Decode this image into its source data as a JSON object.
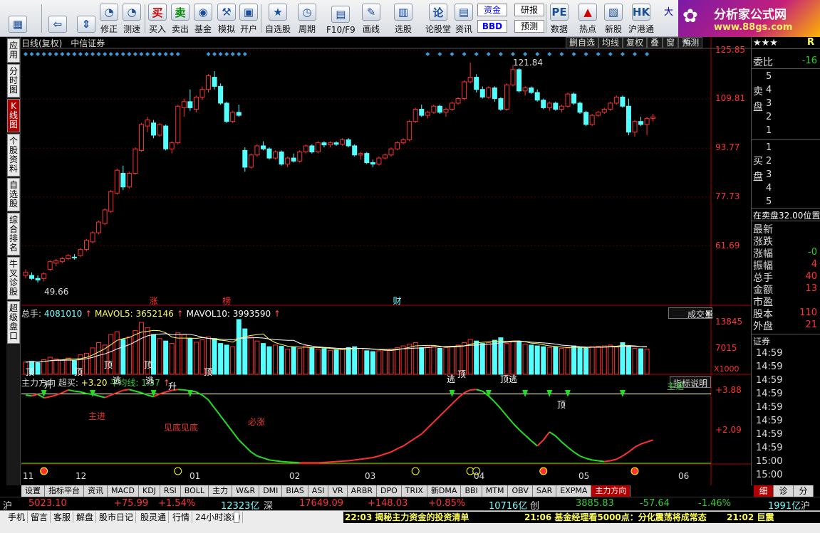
{
  "toolbar": {
    "buttons": [
      {
        "label": "",
        "icon": "app-menu-icon",
        "x": 12
      },
      {
        "label": "",
        "icon": "back-arrow-icon",
        "x": 68
      },
      {
        "label": "",
        "icon": "up-down-icon",
        "x": 108
      },
      {
        "label": "修正",
        "icon": "clock-icon",
        "x": 140
      },
      {
        "label": "测速",
        "icon": "clock-icon",
        "x": 172
      },
      {
        "label": "买入",
        "icon": "buy-icon",
        "glyph": "买",
        "x": 208
      },
      {
        "label": "卖出",
        "icon": "sell-icon",
        "glyph": "卖",
        "x": 240
      },
      {
        "label": "基金",
        "icon": "fund-icon",
        "x": 272
      },
      {
        "label": "模拟",
        "icon": "hammer-icon",
        "x": 305
      },
      {
        "label": "开户",
        "icon": "lock-icon",
        "x": 336
      },
      {
        "label": "自选股",
        "icon": "star-icon",
        "x": 372
      },
      {
        "label": "周期",
        "icon": "cycle-icon",
        "x": 418
      },
      {
        "label": "F10/F9",
        "icon": "f10-icon",
        "x": 458
      },
      {
        "label": "画线",
        "icon": "pen-icon",
        "x": 508
      },
      {
        "label": "选股",
        "icon": "select-icon",
        "x": 553
      },
      {
        "label": "论股堂",
        "icon": "forum-icon",
        "glyph": "论",
        "x": 597
      },
      {
        "label": "资讯",
        "icon": "news-icon",
        "x": 638
      },
      {
        "label": "数据",
        "icon": "pe-icon",
        "glyph": "PE",
        "x": 772
      },
      {
        "label": "热点",
        "icon": "hot-icon",
        "x": 812
      },
      {
        "label": "新股",
        "icon": "new-stock-icon",
        "x": 848
      },
      {
        "label": "沪港通",
        "icon": "hk-icon",
        "glyph": "HK",
        "x": 882
      }
    ],
    "fund_label": "资金",
    "bbd_label": "BBD",
    "research_label": "研报",
    "forecast_label": "预测",
    "big_label": "大"
  },
  "brand": {
    "name": "分析家公式网",
    "url": "www.88gs.com"
  },
  "left_tabs": [
    {
      "label": "应用"
    },
    {
      "label": "分时图"
    },
    {
      "label": "K线图",
      "active": true
    },
    {
      "label": "个股资料"
    },
    {
      "label": "自选股"
    },
    {
      "label": "综合排名"
    },
    {
      "label": "牛叉诊股"
    },
    {
      "label": "超级盘口"
    }
  ],
  "chart_header": {
    "left": "日线(复权)",
    "stock": "中信证券",
    "buttons": [
      "删自选",
      "均线",
      "复权",
      "叠",
      "窗",
      "预测"
    ]
  },
  "price_axis": [
    "125.85",
    "109.81",
    "93.77",
    "77.73",
    "61.69"
  ],
  "annotations": {
    "high": "121.84",
    "low": "49.66",
    "events": [
      {
        "t": "涨",
        "i": 21
      },
      {
        "t": "榜",
        "i": 33
      },
      {
        "t": "财",
        "i": 61
      }
    ]
  },
  "volume": {
    "label": "总手:",
    "value": "4081010",
    "mavol5_label": "MAVOL5:",
    "mavol5": "3652146",
    "mavol10_label": "MAVOL10:",
    "mavol10": "3993590",
    "axis_top": "13845",
    "axis_mid": "7015",
    "axis_unit": "X1000",
    "selector": "成交量"
  },
  "indicator": {
    "name": "主力方向",
    "chao_label": "超买:",
    "chao": "+3.20",
    "avg_label": "平均线:",
    "avg": "1.37",
    "help": "指标说明",
    "axis_top": "+3.88",
    "axis_mid": "+2.09",
    "texts": [
      {
        "t": "顶",
        "x": 6,
        "y": 514,
        "c": "#fff"
      },
      {
        "t": "升",
        "x": 32,
        "y": 532,
        "c": "#fff"
      },
      {
        "t": "顶",
        "x": 74,
        "y": 514,
        "c": "#fff"
      },
      {
        "t": "顶",
        "x": 116,
        "y": 504,
        "c": "#fff"
      },
      {
        "t": "逃",
        "x": 128,
        "y": 526,
        "c": "#fff"
      },
      {
        "t": "顶",
        "x": 172,
        "y": 504,
        "c": "#fff"
      },
      {
        "t": "逃",
        "x": 174,
        "y": 526,
        "c": "#fff"
      },
      {
        "t": "升",
        "x": 206,
        "y": 534,
        "c": "#fff"
      },
      {
        "t": "顶",
        "x": 256,
        "y": 514,
        "c": "#fff"
      },
      {
        "t": "主进",
        "x": 94,
        "y": 576,
        "c": "#e33"
      },
      {
        "t": "见底见底",
        "x": 200,
        "y": 592,
        "c": "#e33"
      },
      {
        "t": "必涨",
        "x": 318,
        "y": 584,
        "c": "#e33"
      },
      {
        "t": "逃",
        "x": 597,
        "y": 524,
        "c": "#fff"
      },
      {
        "t": "顶",
        "x": 612,
        "y": 517,
        "c": "#fff"
      },
      {
        "t": "顶逃",
        "x": 672,
        "y": 524,
        "c": "#fff"
      },
      {
        "t": "顶",
        "x": 752,
        "y": 560,
        "c": "#fff"
      },
      {
        "t": "主退",
        "x": 906,
        "y": 534,
        "c": "#3c3"
      }
    ]
  },
  "date_axis": [
    {
      "t": "11",
      "x": 2
    },
    {
      "t": "12",
      "x": 76
    },
    {
      "t": "01",
      "x": 236
    },
    {
      "t": "02",
      "x": 376
    },
    {
      "t": "03",
      "x": 482
    },
    {
      "t": "04",
      "x": 635
    },
    {
      "t": "05",
      "x": 782
    },
    {
      "t": "06",
      "x": 922
    }
  ],
  "right_panel": {
    "stars": "★★★",
    "r": "R",
    "weibi_label": "委比",
    "weibi": "-16",
    "sell_label": "卖\n盘",
    "buy_label": "买\n盘",
    "sell_levels": [
      "5",
      "4",
      "3",
      "2",
      "1"
    ],
    "buy_levels": [
      "1",
      "2",
      "3",
      "4",
      "5"
    ],
    "info": "在卖盘32.00位置",
    "fields": [
      {
        "k": "最新",
        "v": ""
      },
      {
        "k": "涨跌",
        "v": ""
      },
      {
        "k": "涨幅",
        "v": "-0"
      },
      {
        "k": "振幅",
        "v": "4"
      },
      {
        "k": "总手",
        "v": "40"
      },
      {
        "k": "金额",
        "v": "13"
      },
      {
        "k": "市盈",
        "v": ""
      },
      {
        "k": "股本",
        "v": "110"
      },
      {
        "k": "外盘",
        "v": "21"
      }
    ],
    "sec_label": "证券",
    "times": [
      "14:59",
      "14:59",
      "14:59",
      "14:59",
      "14:59",
      "14:59",
      "14:59",
      "14:59",
      "15:00",
      "15:00"
    ],
    "tabs": [
      "细",
      "诊",
      "分"
    ]
  },
  "bottom_tabs": [
    "设置",
    "指标平台",
    "资讯",
    "MACD",
    "KDJ",
    "RSI",
    "BOLL",
    "主力",
    "W&R",
    "DMI",
    "BIAS",
    "ASI",
    "VR",
    "ARBR",
    "DPO",
    "TRIX",
    "新DMA",
    "BBI",
    "MTM",
    "OBV",
    "SAR",
    "EXPMA",
    "主力方向"
  ],
  "ticker": {
    "sh_label": "沪",
    "sh": "5023.10",
    "sh_chg": "+75.99",
    "sh_pct": "+1.54%",
    "sh_amt": "12323亿",
    "sz_label": "深",
    "sz": "17649.09",
    "sz_chg": "+148.03",
    "sz_pct": "+0.85%",
    "sz_amt": "10716亿",
    "cy_label": "创",
    "cy": "3885.83",
    "cy_chg": "-57.64",
    "cy_pct": "-1.46%",
    "r_amt": "1991亿",
    "r_label": "沪"
  },
  "status": {
    "buttons": [
      "手机",
      "留言",
      "客服",
      "解盘",
      "股市日记",
      "股灵通",
      "行情",
      "24小时滚动"
    ],
    "news": [
      "22:03 揭秘主力资金的投资清单",
      "21:06 基金经理看5000点：分化震荡将成常态",
      "21:02 巨震"
    ]
  },
  "colors": {
    "up": "#ff3030",
    "down": "#54ffff",
    "grid": "#4a0000",
    "axis": "#b00000",
    "yellow": "#ffff55",
    "green": "#22dd22"
  },
  "chart_data": {
    "type": "candlestick",
    "title": "中信证券 日线(复权)",
    "ylim": [
      45,
      126
    ],
    "high": 121.84,
    "low": 49.66,
    "ohlc": [
      [
        52,
        54,
        51,
        53
      ],
      [
        52,
        53,
        50.5,
        51
      ],
      [
        51,
        52,
        49.66,
        50.5
      ],
      [
        51,
        53,
        50,
        52.5
      ],
      [
        54,
        57,
        53.5,
        56.5
      ],
      [
        56,
        57.5,
        55,
        56.8
      ],
      [
        56.5,
        58,
        56,
        57.5
      ],
      [
        57.5,
        59,
        57,
        58.5
      ],
      [
        58,
        59,
        57.2,
        57.8
      ],
      [
        58.5,
        61,
        58,
        60.5
      ],
      [
        60.5,
        64,
        60,
        63.5
      ],
      [
        63,
        66.5,
        62.5,
        66
      ],
      [
        66,
        70,
        65.5,
        69.5
      ],
      [
        69,
        74,
        68.5,
        73.5
      ],
      [
        73,
        80,
        72.5,
        79.5
      ],
      [
        79,
        87,
        78.5,
        86.5
      ],
      [
        85.5,
        88,
        80,
        81
      ],
      [
        81,
        86,
        80.5,
        85.5
      ],
      [
        85.5,
        94,
        85,
        93.5
      ],
      [
        93,
        102,
        92.5,
        101.5
      ],
      [
        101,
        104,
        99,
        103
      ],
      [
        102,
        103,
        97,
        98
      ],
      [
        98,
        102,
        97.5,
        101.5
      ],
      [
        101,
        101.5,
        93,
        93.5
      ],
      [
        93.5,
        96,
        92,
        95.5
      ],
      [
        95.5,
        108,
        95,
        107.5
      ],
      [
        107,
        110,
        104,
        109
      ],
      [
        109,
        113,
        106,
        107
      ],
      [
        106.5,
        111,
        105.5,
        110.5
      ],
      [
        110.5,
        114,
        109.5,
        113
      ],
      [
        113,
        118,
        112,
        117.5
      ],
      [
        117,
        119,
        113,
        114
      ],
      [
        114,
        115,
        108,
        108.5
      ],
      [
        108.5,
        109,
        102,
        102.5
      ],
      [
        102.5,
        106,
        102,
        105.5
      ],
      [
        105.5,
        108,
        104,
        104.5
      ],
      [
        93,
        94,
        86,
        87.5
      ],
      [
        87.5,
        92,
        87,
        91.5
      ],
      [
        91.5,
        95,
        91,
        94.5
      ],
      [
        94.5,
        96,
        93,
        93.5
      ],
      [
        93.5,
        94,
        90,
        90.5
      ],
      [
        90.5,
        93,
        90,
        92.5
      ],
      [
        92.5,
        93,
        88,
        88.5
      ],
      [
        88.5,
        91,
        87.5,
        90.5
      ],
      [
        90.5,
        92,
        89,
        89.5
      ],
      [
        89.5,
        93,
        89,
        92.5
      ],
      [
        92.5,
        95,
        92,
        94.5
      ],
      [
        94.5,
        95,
        92,
        92.5
      ],
      [
        92.5,
        96,
        92,
        95.5
      ],
      [
        95.5,
        96,
        94,
        94.8
      ],
      [
        94.8,
        96,
        94,
        95.5
      ],
      [
        95.5,
        96,
        94.5,
        95
      ],
      [
        95,
        97,
        94.5,
        96.5
      ],
      [
        96.5,
        97,
        94,
        94.5
      ],
      [
        94.5,
        95,
        91,
        91.5
      ],
      [
        91.5,
        92.5,
        90,
        92
      ],
      [
        92,
        92.5,
        88.5,
        89
      ],
      [
        89,
        90,
        87.5,
        88.5
      ],
      [
        88.5,
        91,
        88,
        90.5
      ],
      [
        90.5,
        92,
        90,
        91.5
      ],
      [
        91.5,
        94,
        91,
        93.5
      ],
      [
        93.5,
        96,
        93,
        95.5
      ],
      [
        95.5,
        97,
        95,
        96.5
      ],
      [
        96.5,
        103,
        96,
        102.5
      ],
      [
        102.5,
        107,
        102,
        106.5
      ],
      [
        106.5,
        108,
        104,
        104.5
      ],
      [
        104.5,
        106,
        103.5,
        105.5
      ],
      [
        105.5,
        108,
        105,
        107.5
      ],
      [
        107.5,
        108,
        105,
        105.5
      ],
      [
        105.5,
        107,
        104,
        106.5
      ],
      [
        106.5,
        109,
        106,
        108.5
      ],
      [
        108.5,
        110.5,
        108,
        110
      ],
      [
        110,
        116,
        109.5,
        115.5
      ],
      [
        115.5,
        121.84,
        115,
        117
      ],
      [
        117,
        118,
        112,
        113
      ],
      [
        113,
        114,
        110,
        110.5
      ],
      [
        110.5,
        114,
        110,
        113.5
      ],
      [
        113.5,
        114,
        109,
        110
      ],
      [
        110,
        110.5,
        106,
        106.5
      ],
      [
        106.5,
        115,
        106,
        114.5
      ],
      [
        114.5,
        121,
        114,
        119.5
      ],
      [
        119.5,
        120,
        112,
        112.5
      ],
      [
        112.5,
        114,
        111,
        113.5
      ],
      [
        113.5,
        114,
        111.5,
        112
      ],
      [
        112,
        113,
        109,
        109.5
      ],
      [
        109.5,
        110,
        106.5,
        107
      ],
      [
        107,
        109,
        106,
        108.5
      ],
      [
        108.5,
        109,
        106,
        106.5
      ],
      [
        106.5,
        108,
        105.5,
        107.5
      ],
      [
        107.5,
        112,
        107,
        111.5
      ],
      [
        111.5,
        112,
        108,
        108.5
      ],
      [
        108.5,
        109,
        105,
        105.5
      ],
      [
        105.5,
        106,
        101,
        101.5
      ],
      [
        101.5,
        105,
        101,
        104.5
      ],
      [
        104.5,
        106,
        104,
        105.5
      ],
      [
        105.5,
        107,
        105,
        106.5
      ],
      [
        106.5,
        109,
        106,
        108.5
      ],
      [
        108.5,
        111,
        108,
        110.5
      ],
      [
        110.5,
        111,
        107,
        107.5
      ],
      [
        107.5,
        110,
        98,
        99
      ],
      [
        99,
        103,
        97.5,
        102.5
      ],
      [
        102.5,
        104,
        101,
        101.5
      ],
      [
        101.5,
        104,
        98,
        103.5
      ],
      [
        103.5,
        105,
        102.5,
        104
      ]
    ],
    "volume": [
      3000,
      3200,
      2800,
      3600,
      4200,
      3800,
      3500,
      4000,
      3300,
      4800,
      5200,
      6500,
      7800,
      7200,
      9800,
      10500,
      8600,
      9200,
      10800,
      12800,
      11500,
      9800,
      8800,
      8200,
      7600,
      10200,
      9800,
      8800,
      7900,
      8500,
      9200,
      8800,
      7600,
      7200,
      6800,
      13500,
      11200,
      9200,
      8200,
      7600,
      6800,
      7200,
      6900,
      6200,
      6800,
      6400,
      7000,
      6600,
      6200,
      6300,
      5900,
      6000,
      6200,
      6600,
      6800,
      6400,
      5800,
      5600,
      5800,
      6000,
      6200,
      6600,
      7000,
      7400,
      7800,
      6600,
      6800,
      7000,
      6400,
      6600,
      6800,
      7200,
      7800,
      8600,
      8200,
      7600,
      7800,
      8400,
      9000,
      7600,
      8200,
      8000,
      7400,
      7200,
      7000,
      6800,
      6600,
      6700,
      6400,
      6500,
      7000,
      6600,
      6400,
      6800,
      6900,
      7000,
      7200,
      6700,
      7800,
      6900,
      6400,
      6300,
      6200
    ],
    "trend": [
      3.72,
      3.7,
      3.74,
      3.65,
      3.68,
      3.72,
      3.78,
      3.85,
      3.82,
      3.8,
      3.76,
      3.74,
      3.7,
      3.66,
      3.72,
      3.78,
      3.84,
      3.86,
      3.82,
      3.78,
      3.72,
      3.68,
      3.75,
      3.8,
      3.84,
      3.86,
      3.85,
      3.83,
      3.8,
      3.72,
      3.6,
      3.4,
      3.2,
      3.0,
      2.8,
      2.6,
      2.45,
      2.3,
      2.2,
      2.15,
      2.1,
      2.08,
      2.06,
      2.05,
      2.04,
      2.03,
      2.03,
      2.03,
      2.03,
      2.04,
      2.05,
      2.06,
      2.07,
      2.08,
      2.1,
      2.12,
      2.14,
      2.16,
      2.2,
      2.25,
      2.3,
      2.38,
      2.45,
      2.55,
      2.65,
      2.75,
      2.9,
      3.05,
      3.2,
      3.35,
      3.5,
      3.65,
      3.78,
      3.85,
      3.86,
      3.82,
      3.7,
      3.55,
      3.38,
      3.2,
      3.02,
      2.86,
      2.72,
      2.58,
      2.45,
      2.6,
      2.8,
      2.7,
      2.55,
      2.42,
      2.3,
      2.2,
      2.14,
      2.1,
      2.08,
      2.06,
      2.08,
      2.12,
      2.2,
      2.3,
      2.42,
      2.5,
      2.55,
      2.6
    ],
    "y_range": [
      2.0,
      3.92
    ],
    "level": 3.75
  }
}
